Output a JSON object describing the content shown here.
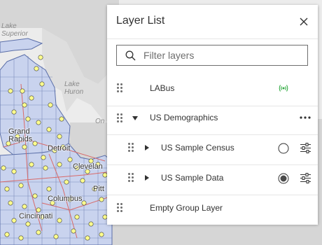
{
  "map": {
    "water_labels": [
      "Lake Superior",
      "Lake Huron",
      "Lake Ontario"
    ],
    "cities": [
      "Grand Rapids",
      "Detroit",
      "Cleveland",
      "Pittsburgh",
      "Columbus",
      "Cincinnati"
    ],
    "city_label_text": {
      "grand": "Grand",
      "rapids": "Rapids",
      "detroit": "Detroit",
      "cleveland": "Clevelan",
      "pittsburgh": "Pitt",
      "columbus": "Columbus",
      "cincinnati": "Cincinnati"
    },
    "water_label_text": {
      "lake": "Lake",
      "superior": "Superior",
      "lake2": "Lake",
      "huron": "Huron",
      "on": "On"
    },
    "colors": {
      "land": "#d6d6d6",
      "water": "#ececec",
      "counties_fill": "#c9d3ee",
      "county_lines": "#5a6ea8",
      "roads": "#d86a6a",
      "points": "#ffff8c"
    }
  },
  "layer_list": {
    "title": "Layer List",
    "close_icon": "close-icon",
    "filter_placeholder": "Filter layers",
    "filter_value": "",
    "layers": [
      {
        "label": "LABus",
        "level": 0,
        "status_icon": "live-stream-icon",
        "status_color": "#35ac46"
      },
      {
        "label": "US Demographics",
        "level": 0,
        "expanded": true,
        "actions_icon": "ellipsis-icon"
      },
      {
        "label": "US Sample Census",
        "level": 1,
        "expanded": false,
        "visible": false,
        "options_icon": "sliders-icon"
      },
      {
        "label": "US Sample Data",
        "level": 1,
        "expanded": false,
        "visible": true,
        "options_icon": "sliders-icon"
      },
      {
        "label": "Empty Group Layer",
        "level": 0
      }
    ]
  }
}
